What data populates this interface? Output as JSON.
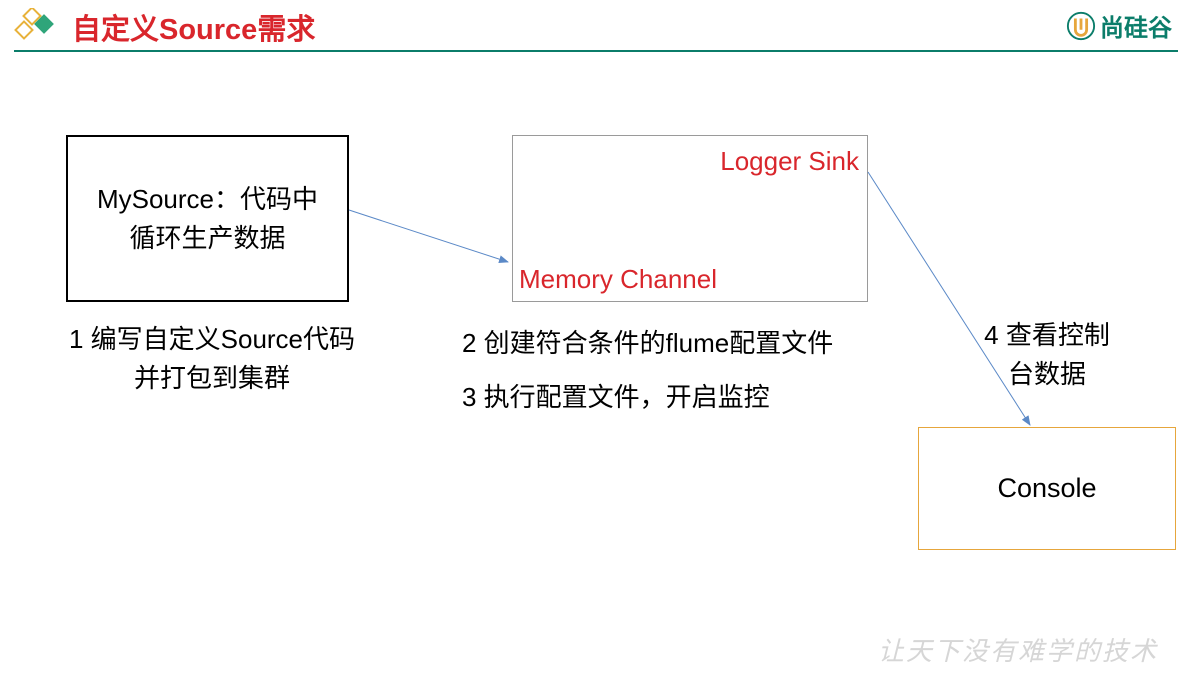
{
  "header": {
    "title": "自定义Source需求",
    "brand": "尚硅谷"
  },
  "source_box": {
    "line1": "MySource：代码中",
    "line2": "循环生产数据"
  },
  "channel_box": {
    "logger_sink": "Logger Sink",
    "memory_channel": "Memory Channel"
  },
  "console_box": {
    "label": "Console"
  },
  "steps": {
    "s1_line1": "1 编写自定义Source代码",
    "s1_line2": "并打包到集群",
    "s2": "2 创建符合条件的flume配置文件",
    "s3": "3 执行配置文件，开启监控",
    "s4_line1": "4 查看控制",
    "s4_line2": "台数据"
  },
  "footer": {
    "tagline": "让天下没有难学的技术"
  }
}
